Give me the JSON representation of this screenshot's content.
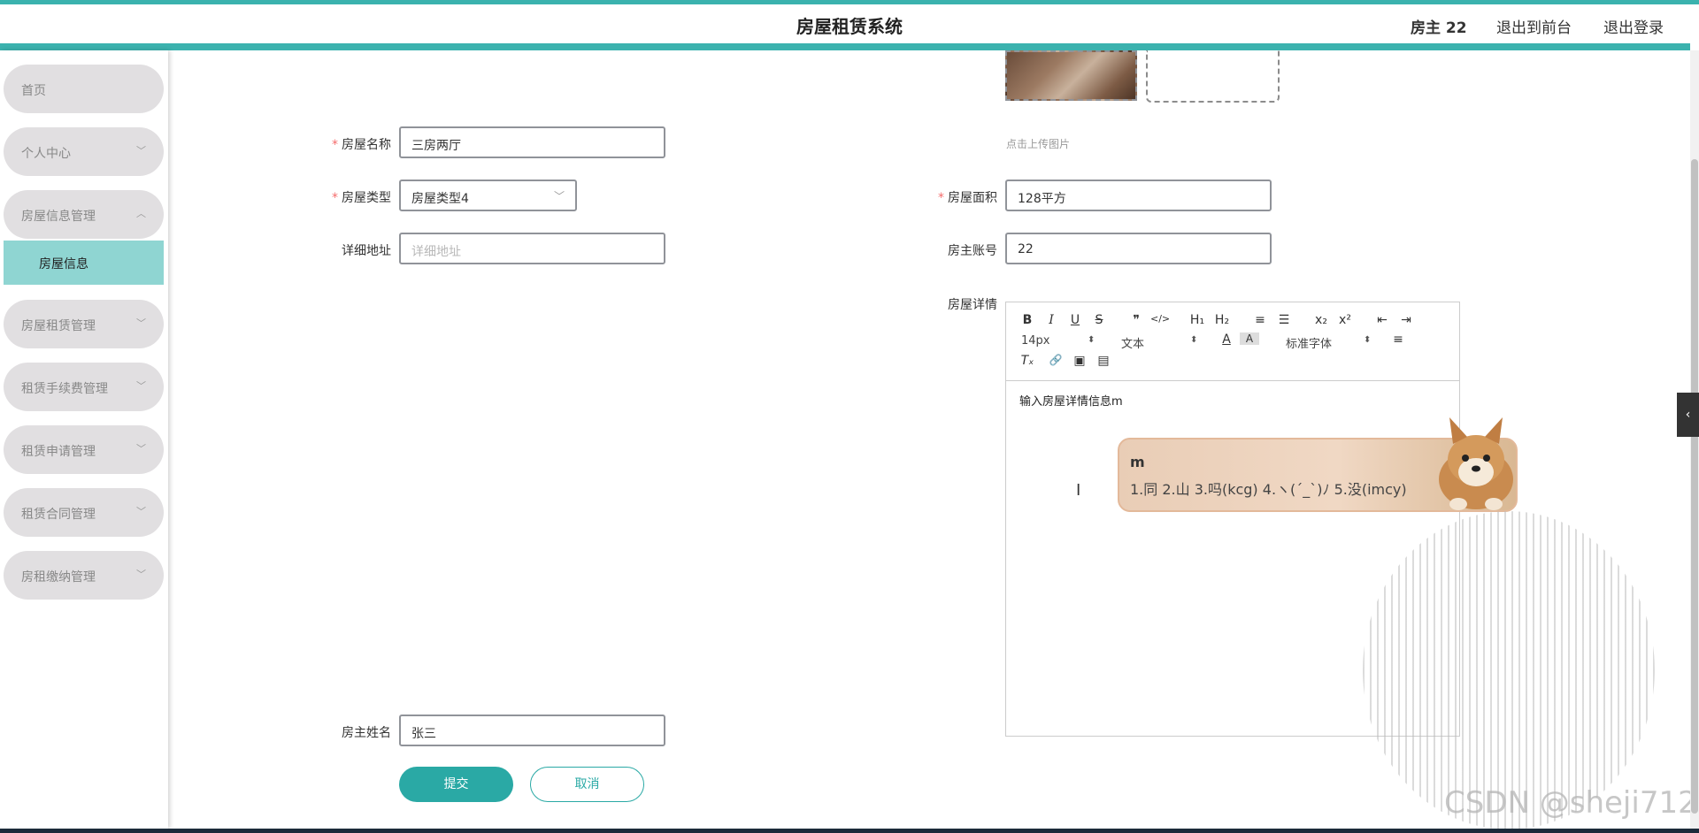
{
  "header": {
    "title": "房屋租赁系统",
    "user": "房主 22",
    "back_to_front": "退出到前台",
    "logout": "退出登录"
  },
  "sidebar": {
    "items": [
      {
        "label": "首页",
        "has_chevron": false
      },
      {
        "label": "个人中心",
        "chevron": "﹀"
      },
      {
        "label": "房屋信息管理",
        "chevron": "︿"
      },
      {
        "label": "房屋租赁管理",
        "chevron": "﹀"
      },
      {
        "label": "租赁手续费管理",
        "chevron": "﹀"
      },
      {
        "label": "租赁申请管理",
        "chevron": "﹀"
      },
      {
        "label": "租赁合同管理",
        "chevron": "﹀"
      },
      {
        "label": "房租缴纳管理",
        "chevron": "﹀"
      }
    ],
    "active_sub": "房屋信息"
  },
  "form": {
    "upload_tip": "点击上传图片",
    "house_name": {
      "label": "房屋名称",
      "value": "三房两厅",
      "required": "*"
    },
    "house_type": {
      "label": "房屋类型",
      "value": "房屋类型4",
      "required": "*"
    },
    "house_area": {
      "label": "房屋面积",
      "value": "128平方",
      "required": "*"
    },
    "address": {
      "label": "详细地址",
      "placeholder": "详细地址"
    },
    "owner_account": {
      "label": "房主账号",
      "value": "22"
    },
    "details": {
      "label": "房屋详情"
    },
    "owner_name": {
      "label": "房主姓名",
      "value": "张三"
    },
    "submit": "提交",
    "cancel": "取消"
  },
  "editor": {
    "font_size": "14px",
    "block_type": "文本",
    "font_family": "标准字体",
    "content": "输入房屋详情信息m",
    "buttons": {
      "bold": "B",
      "italic": "I",
      "underline": "U",
      "strike": "S",
      "quote": "❞",
      "code": "</>",
      "h1": "H₁",
      "h2": "H₂",
      "ol": "≡",
      "ul": "☰",
      "sub": "x₂",
      "sup": "x²",
      "outdent": "⇤",
      "indent": "⇥",
      "color": "A",
      "background": "A",
      "align": "≡",
      "clean": "Tₓ",
      "link": "🔗",
      "image": "▣",
      "video": "▤"
    }
  },
  "ime": {
    "composition": "m",
    "candidates": "1.同  2.山  3.吗(kcg)  4.ヽ(ˊ_ˋ)ﾉ  5.没(imcy)"
  },
  "icons": {
    "upload_image": "upload-thumb",
    "select_arrow": "﹀",
    "side_tab": "‹"
  },
  "watermark": "CSDN @sheji712",
  "colors": {
    "accent": "#3bb2ae",
    "active_menu": "#8fd5d2",
    "required": "#f56c6c",
    "submit": "#2aa9a5"
  }
}
